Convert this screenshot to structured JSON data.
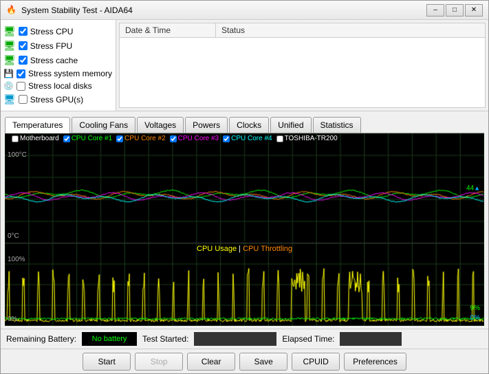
{
  "window": {
    "title": "System Stability Test - AIDA64",
    "icon": "🔥"
  },
  "titlebar_buttons": {
    "minimize": "–",
    "maximize": "□",
    "close": "✕"
  },
  "checkboxes": [
    {
      "label": "Stress CPU",
      "checked": true,
      "icon": "🖥"
    },
    {
      "label": "Stress FPU",
      "checked": true,
      "icon": "🖥"
    },
    {
      "label": "Stress cache",
      "checked": true,
      "icon": "🖥"
    },
    {
      "label": "Stress system memory",
      "checked": true,
      "icon": "💾"
    },
    {
      "label": "Stress local disks",
      "checked": false,
      "icon": "💿"
    },
    {
      "label": "Stress GPU(s)",
      "checked": false,
      "icon": "🖥"
    }
  ],
  "log_columns": {
    "date_time": "Date & Time",
    "status": "Status"
  },
  "tabs": [
    {
      "label": "Temperatures",
      "active": true
    },
    {
      "label": "Cooling Fans",
      "active": false
    },
    {
      "label": "Voltages",
      "active": false
    },
    {
      "label": "Powers",
      "active": false
    },
    {
      "label": "Clocks",
      "active": false
    },
    {
      "label": "Unified",
      "active": false
    },
    {
      "label": "Statistics",
      "active": false
    }
  ],
  "chart_top": {
    "legend": [
      {
        "label": "Motherboard",
        "color": "#fff",
        "checked": false
      },
      {
        "label": "CPU Core #1",
        "color": "#0f0",
        "checked": true
      },
      {
        "label": "CPU Core #2",
        "color": "#f80",
        "checked": true
      },
      {
        "label": "CPU Core #3",
        "color": "#f0f",
        "checked": true
      },
      {
        "label": "CPU Core #4",
        "color": "#0ff",
        "checked": true
      },
      {
        "label": "TOSHIBA-TR200",
        "color": "#fff",
        "checked": false
      }
    ],
    "y_max": "100°C",
    "y_min": "0°C",
    "value_right": "44"
  },
  "chart_bottom": {
    "title_left": "CPU Usage",
    "title_sep": "|",
    "title_right": "CPU Throttling",
    "title_left_color": "#ff0",
    "title_right_color": "#f80",
    "y_max": "100%",
    "y_min": "0%",
    "value_right_green": "9%",
    "value_right_blue": "0%"
  },
  "status_bar": {
    "battery_label": "Remaining Battery:",
    "battery_value": "No battery",
    "test_started_label": "Test Started:",
    "test_started_value": "",
    "elapsed_label": "Elapsed Time:",
    "elapsed_value": ""
  },
  "buttons": {
    "start": "Start",
    "stop": "Stop",
    "clear": "Clear",
    "save": "Save",
    "cpuid": "CPUID",
    "preferences": "Preferences"
  }
}
